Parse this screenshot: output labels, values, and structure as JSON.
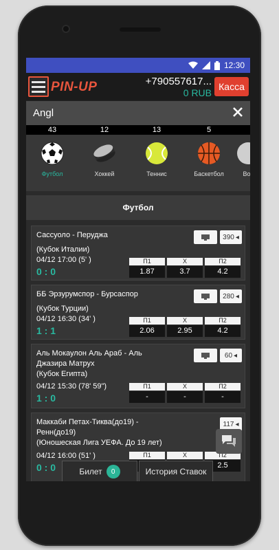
{
  "status": {
    "time": "12:30"
  },
  "header": {
    "logo": "PIN-UP",
    "phone": "+790557617...",
    "balance": "0 RUB",
    "cashier": "Касса"
  },
  "search": {
    "value": "Angl"
  },
  "sports": [
    {
      "count": "43",
      "label": "Футбол",
      "icon": "soccer-ball-icon",
      "active": true
    },
    {
      "count": "12",
      "label": "Хоккей",
      "icon": "hockey-puck-icon"
    },
    {
      "count": "13",
      "label": "Теннис",
      "icon": "tennis-ball-icon"
    },
    {
      "count": "5",
      "label": "Баскетбол",
      "icon": "basketball-icon"
    },
    {
      "count": "",
      "label": "Во",
      "icon": "volleyball-icon"
    }
  ],
  "section_title": "Футбол",
  "odds_headers": [
    "П1",
    "Х",
    "П2"
  ],
  "events": [
    {
      "name": "Сассуоло - Перуджа",
      "tournament": "(Кубок Италии)",
      "time": "04/12 17:00 (5' )",
      "score": "0 : 0",
      "more": "390",
      "odds": [
        "1.87",
        "3.7",
        "4.2"
      ]
    },
    {
      "name": "ББ Эрзурумспор - Бурсаспор",
      "tournament": "(Кубок Турции)",
      "time": "04/12 16:30 (34' )",
      "score": "1 : 1",
      "more": "280",
      "odds": [
        "2.06",
        "2.95",
        "4.2"
      ]
    },
    {
      "name": "Аль Мокаулон Аль Араб - Аль Джазира Матрух",
      "tournament": "(Кубок Египта)",
      "time": "04/12 15:30 (78' 59\")",
      "score": "1 : 0",
      "more": "60",
      "odds": [
        "-",
        "-",
        "-"
      ]
    },
    {
      "name": "Маккаби Петах-Тиква(до19) - Ренн(до19)",
      "tournament": "(Юношеская Лига УЕФА. До 19 лет)",
      "time": "04/12 16:00 (51' )",
      "score": "0 : 0",
      "more": "117",
      "odds": [
        "",
        "",
        "2.5"
      ]
    }
  ],
  "bottom": {
    "ticket_label": "Билет",
    "ticket_count": "0",
    "history_label": "История Ставок"
  },
  "colors": {
    "accent": "#29b9a0",
    "brand": "#e8553d",
    "statusbar": "#3f4fc0"
  }
}
